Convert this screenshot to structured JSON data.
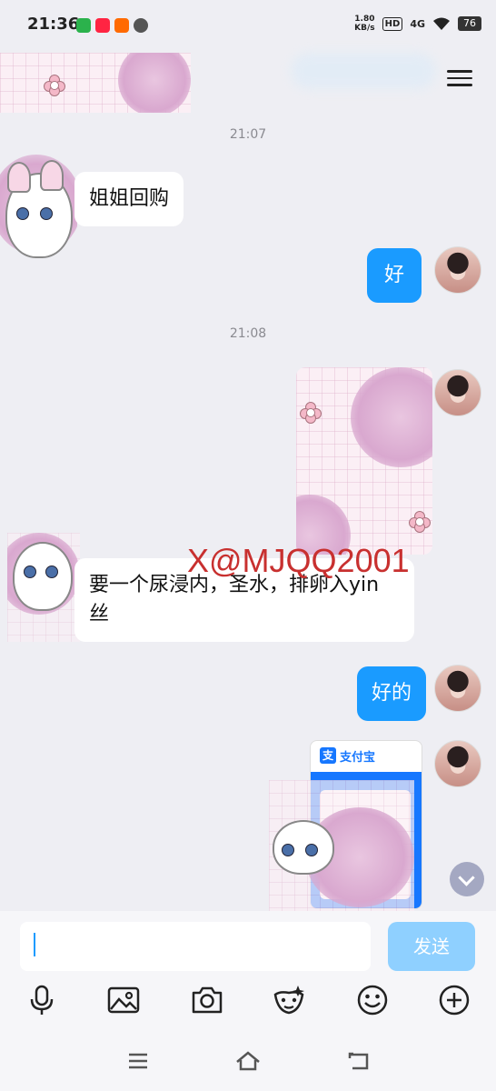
{
  "status": {
    "time": "21:36",
    "net_speed_value": "1.80",
    "net_speed_unit": "KB/s",
    "hd": "HD",
    "signal": "4G",
    "battery": "76"
  },
  "chat": {
    "timestamp_1": "21:07",
    "timestamp_2": "21:08",
    "messages": [
      {
        "side": "left",
        "text": "姐姐回购"
      },
      {
        "side": "right",
        "text": "好"
      },
      {
        "side": "left",
        "text_line1": "要一个尿浸内，圣水，排卵入yin",
        "text_line2": "丝"
      },
      {
        "side": "right",
        "text": "好的"
      }
    ],
    "watermark": "X@MJQQ2001",
    "payment_card": {
      "brand_icon": "支",
      "brand_name": "支付宝"
    }
  },
  "input": {
    "placeholder": "",
    "send_label": "发送"
  },
  "icons": {
    "menu": "menu-icon",
    "voice": "microphone-icon",
    "image": "image-icon",
    "camera": "camera-icon",
    "sticker": "sticker-icon",
    "emoji": "emoji-icon",
    "plus": "plus-icon"
  },
  "colors": {
    "bubble_right": "#1a9bff",
    "send_button": "#8fd0ff",
    "watermark": "#c8302f"
  }
}
